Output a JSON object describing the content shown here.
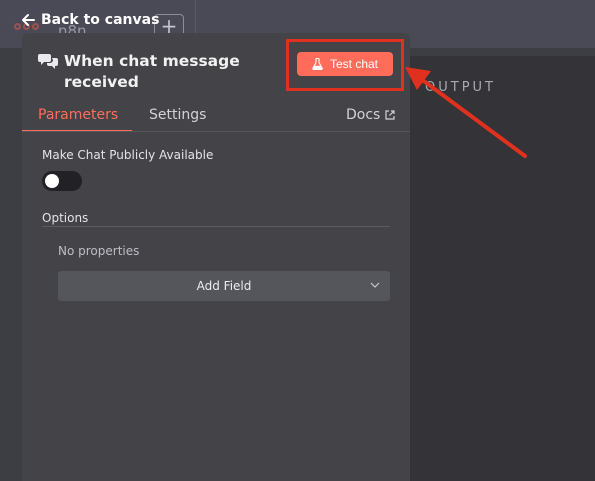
{
  "nav": {
    "back_label": "Back to canvas",
    "app_name": "n8n",
    "add_label": "+"
  },
  "output": {
    "label": "OUTPUT"
  },
  "node": {
    "title": "When chat message received",
    "test_button_label": "Test chat",
    "icons": {
      "chat": "chat-bubbles-icon",
      "flask": "flask-icon",
      "external": "external-link-icon",
      "chevron": "chevron-down-icon"
    }
  },
  "tabs": {
    "parameters": "Parameters",
    "settings": "Settings",
    "docs": "Docs",
    "active": "Parameters"
  },
  "parameters": {
    "public_label": "Make Chat Publicly Available",
    "public_enabled": false,
    "options_label": "Options",
    "no_properties": "No properties",
    "add_field_label": "Add Field"
  },
  "colors": {
    "accent": "#ff6d5a",
    "annotation": "#e0311f",
    "panel": "#434348",
    "background": "#3d3d44"
  }
}
